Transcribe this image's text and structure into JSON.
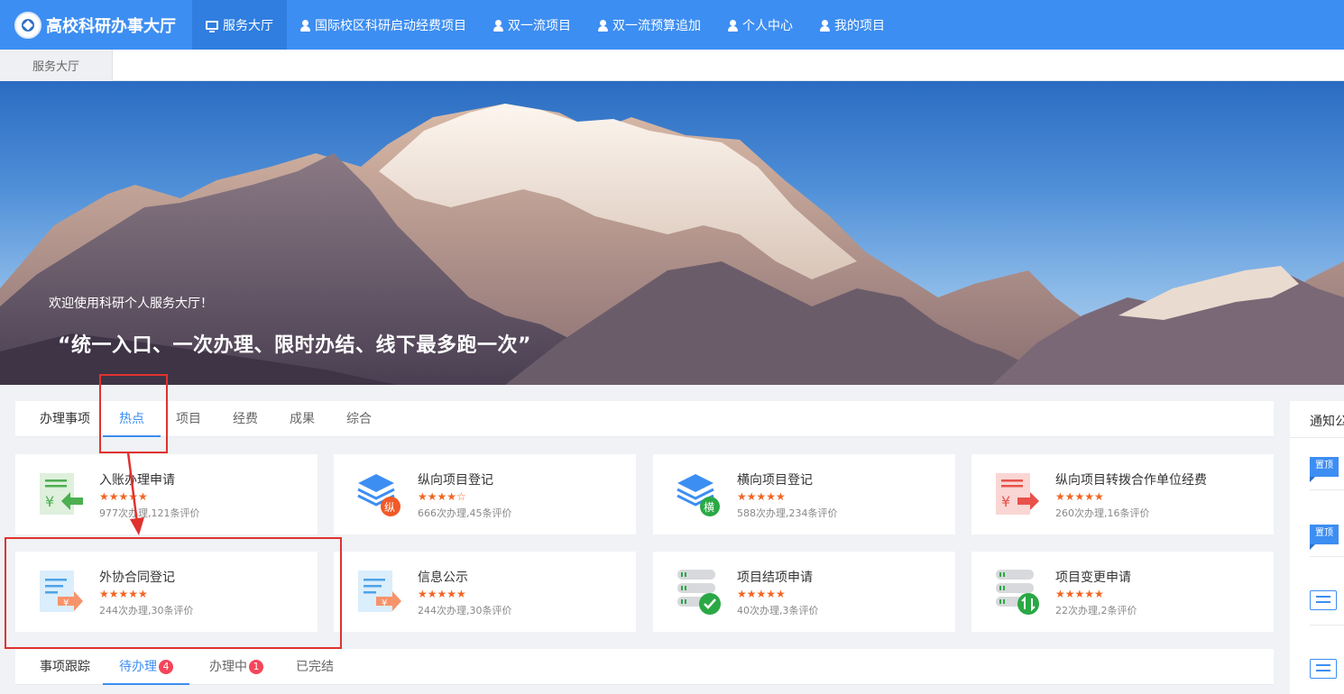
{
  "header": {
    "brand": "高校科研办事大厅",
    "nav": [
      {
        "label": "服务大厅",
        "icon": "monitor-icon",
        "active": true
      },
      {
        "label": "国际校区科研启动经费项目",
        "icon": "user-icon"
      },
      {
        "label": "双一流项目",
        "icon": "user-icon"
      },
      {
        "label": "双一流预算追加",
        "icon": "user-icon"
      },
      {
        "label": "个人中心",
        "icon": "user-icon"
      },
      {
        "label": "我的项目",
        "icon": "user-icon"
      }
    ]
  },
  "breadcrumb": {
    "tab": "服务大厅"
  },
  "banner": {
    "welcome": "欢迎使用科研个人服务大厅！",
    "slogan": "“统一入口、一次办理、限时办结、线下最多跑一次”"
  },
  "categories": {
    "label": "办理事项",
    "tabs": [
      "热点",
      "项目",
      "经费",
      "成果",
      "综合"
    ],
    "active": "热点"
  },
  "services": [
    {
      "title": "入账办理申请",
      "stars": "★★★★★",
      "rating": 5,
      "meta": "977次办理,121条评价",
      "icon": "income-register-icon"
    },
    {
      "title": "纵向项目登记",
      "stars": "★★★★☆",
      "rating": 4.5,
      "meta": "666次办理,45条评价",
      "icon": "vertical-project-icon",
      "icon_badge": "纵"
    },
    {
      "title": "横向项目登记",
      "stars": "★★★★★",
      "rating": 5,
      "meta": "588次办理,234条评价",
      "icon": "horizontal-project-icon",
      "icon_badge": "横"
    },
    {
      "title": "纵向项目转拨合作单位经费",
      "stars": "★★★★★",
      "rating": 5,
      "meta": "260次办理,16条评价",
      "icon": "transfer-funds-icon"
    },
    {
      "title": "外协合同登记",
      "stars": "★★★★★",
      "rating": 5,
      "meta": "244次办理,30条评价",
      "icon": "contract-register-icon"
    },
    {
      "title": "信息公示",
      "stars": "★★★★★",
      "rating": 5,
      "meta": "244次办理,30条评价",
      "icon": "info-publicity-icon"
    },
    {
      "title": "项目结项申请",
      "stars": "★★★★★",
      "rating": 5,
      "meta": "40次办理,3条评价",
      "icon": "project-close-icon"
    },
    {
      "title": "项目变更申请",
      "stars": "★★★★★",
      "rating": 5,
      "meta": "22次办理,2条评价",
      "icon": "project-change-icon"
    }
  ],
  "tracking": {
    "label": "事项跟踪",
    "tabs": [
      {
        "label": "待办理",
        "badge": "4",
        "active": true
      },
      {
        "label": "办理中",
        "badge": "1"
      },
      {
        "label": "已完结"
      }
    ]
  },
  "notice": {
    "heading": "通知公",
    "pin_tag": "置顶"
  },
  "colors": {
    "primary": "#3d8ef2",
    "star": "#f26522",
    "badge": "#f5455a",
    "annotation": "#e0322f"
  }
}
